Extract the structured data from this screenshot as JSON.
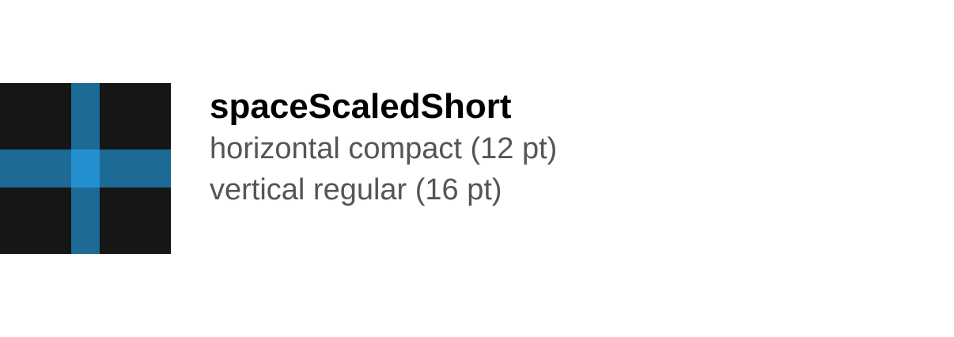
{
  "token": {
    "name": "spaceScaledShort",
    "horizontal": "horizontal compact (12 pt)",
    "vertical": "vertical regular (16 pt)"
  },
  "colors": {
    "background": "#161616",
    "band": "#1e6a96",
    "intersection": "#2490d0",
    "title": "#000000",
    "subtitle": "#555555"
  }
}
